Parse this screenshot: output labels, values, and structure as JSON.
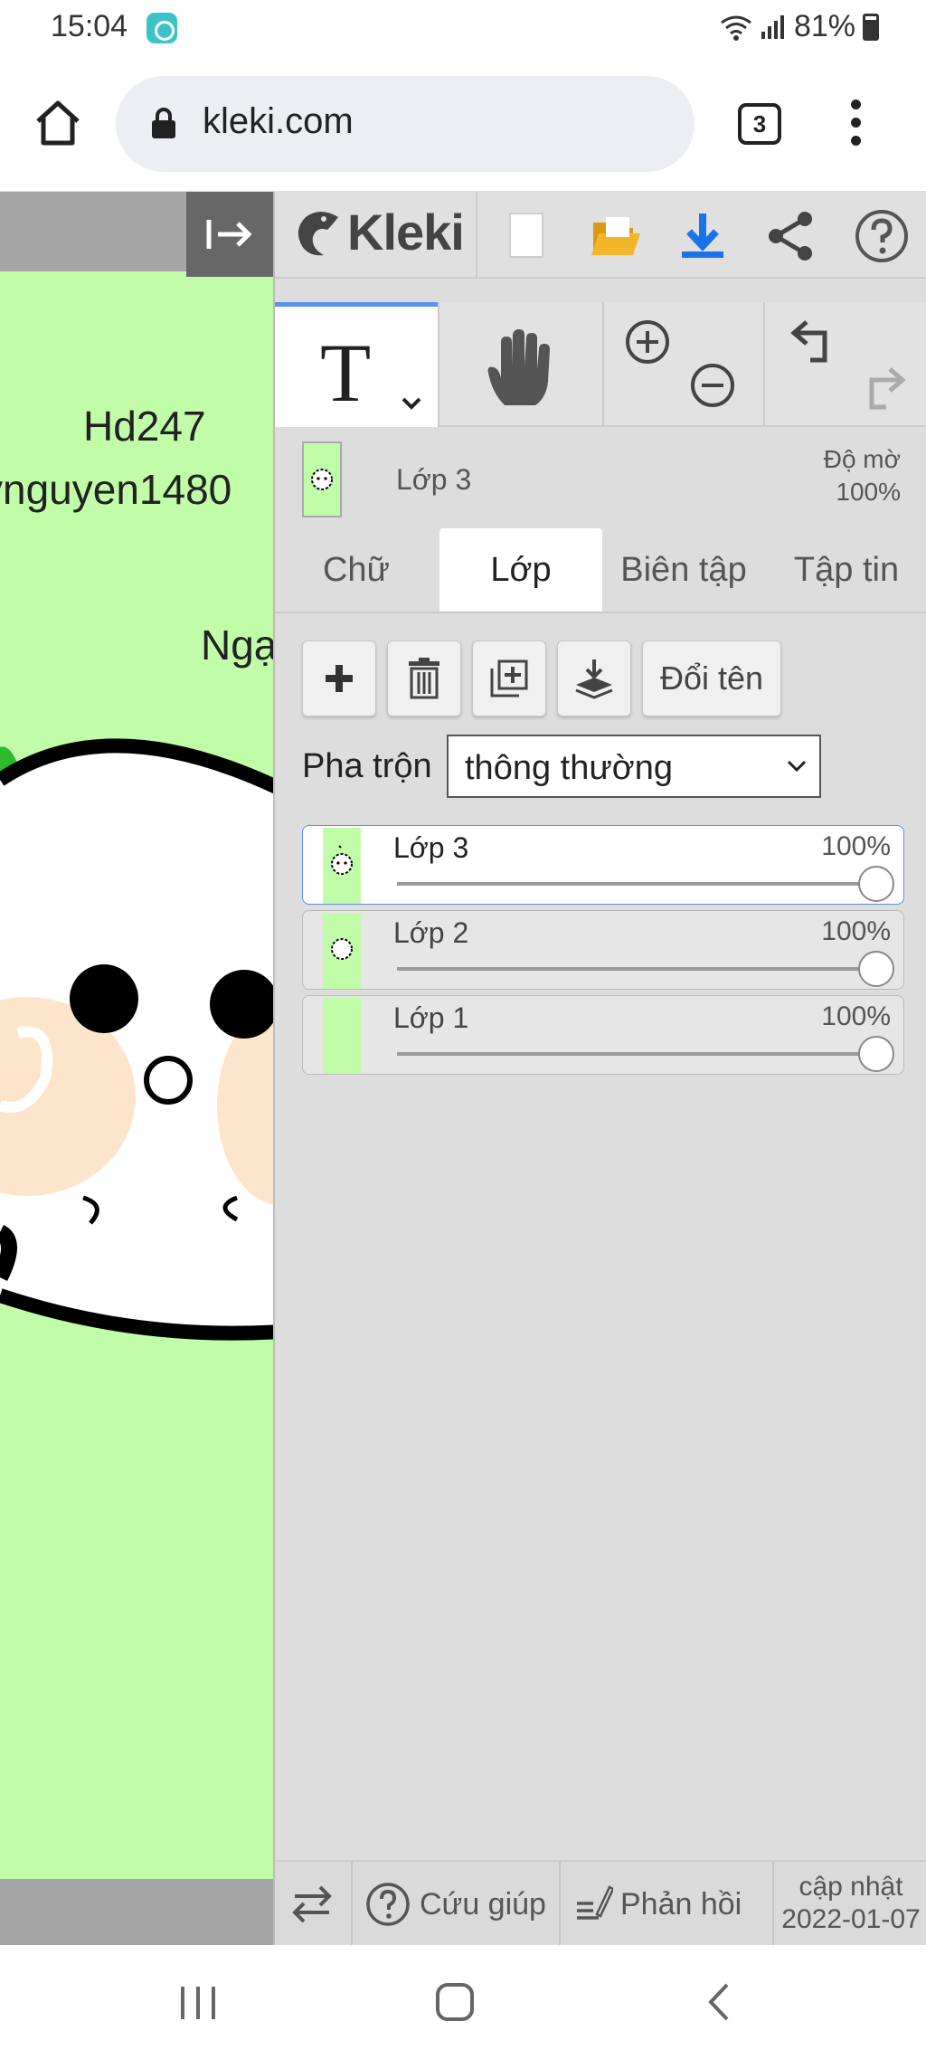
{
  "status": {
    "time": "15:04",
    "battery": "81%"
  },
  "browser": {
    "url": "kleki.com",
    "tab_count": "3"
  },
  "canvas": {
    "text_line1": "Hd247",
    "text_line2": "ynguyen1480",
    "text_line3": "Ngạ"
  },
  "topbar": {
    "logo_text": "Kleki"
  },
  "layer_info": {
    "name": "Lớp 3",
    "opacity_label": "Độ mờ",
    "opacity_value": "100%"
  },
  "tabs": [
    {
      "label": "Chữ"
    },
    {
      "label": "Lớp"
    },
    {
      "label": "Biên tập"
    },
    {
      "label": "Tập tin"
    }
  ],
  "layer_buttons": {
    "rename": "Đổi tên"
  },
  "blend": {
    "label": "Pha trộn",
    "value": "thông thường"
  },
  "layers": [
    {
      "name": "Lớp 3",
      "opacity": "100%",
      "selected": true
    },
    {
      "name": "Lớp 2",
      "opacity": "100%",
      "selected": false
    },
    {
      "name": "Lớp 1",
      "opacity": "100%",
      "selected": false
    }
  ],
  "footer": {
    "help": "Cứu giúp",
    "feedback": "Phản hồi",
    "update_label": "cập nhật",
    "update_date": "2022-01-07"
  },
  "colors": {
    "accent": "#5b8ff0",
    "canvas_bg": "#c1fda9",
    "panel_bg": "#dddddd",
    "download": "#1a73e8",
    "folder": "#f3b52a"
  }
}
